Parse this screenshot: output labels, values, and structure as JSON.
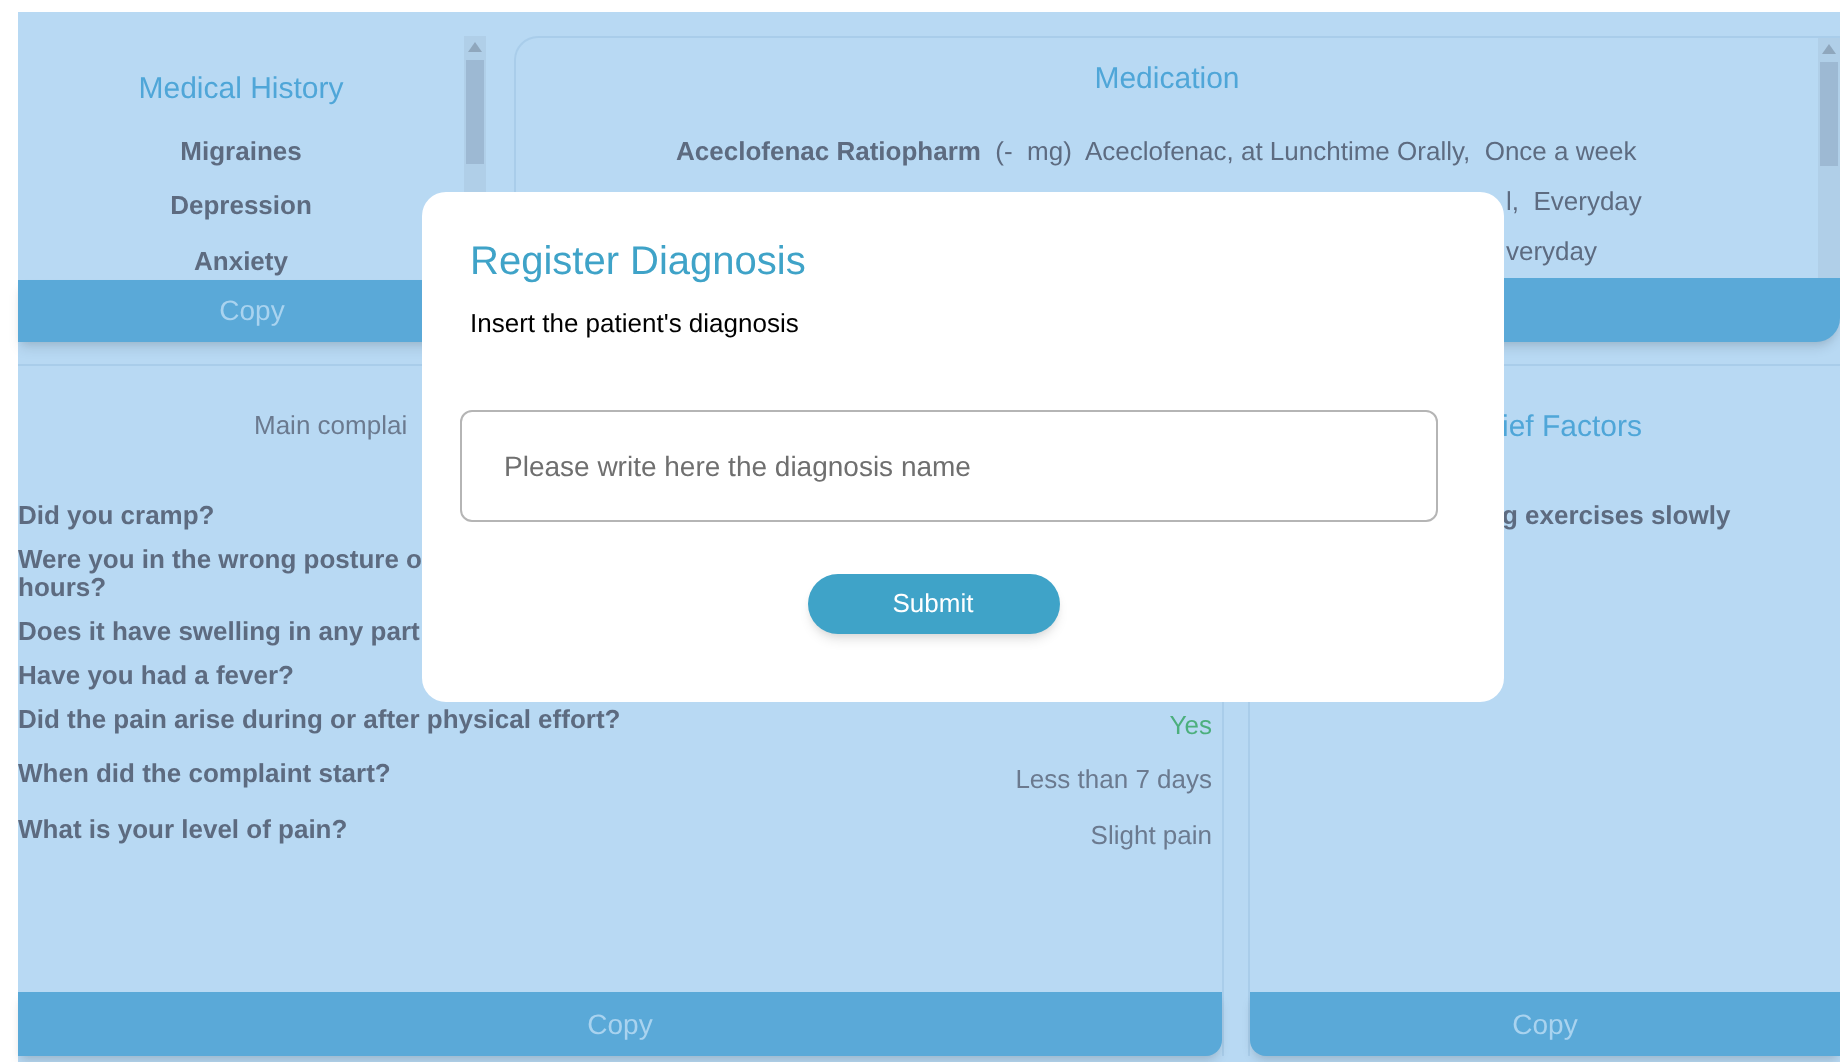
{
  "medical_history": {
    "title": "Medical History",
    "items": [
      "Migraines",
      "Depression",
      "Anxiety"
    ],
    "copy_label": "Copy"
  },
  "medication": {
    "title": "Medication",
    "rows": [
      {
        "name": "Aceclofenac Ratiopharm",
        "details": "(-  mg)  Aceclofenac, at Lunchtime Orally,  Once a week"
      },
      {
        "tail": "l,  Everyday"
      },
      {
        "tail": "veryday"
      }
    ]
  },
  "complaint": {
    "title": "Main complai",
    "questions": [
      {
        "text": "Did you cramp?"
      },
      {
        "text": "Were you in the wrong posture o\nhours?"
      },
      {
        "text": "Does it have swelling in any part"
      },
      {
        "text": "Have you had a fever?"
      },
      {
        "text": "Did the pain arise during or after physical effort?",
        "answer": "Yes",
        "color": "#4caf7d"
      },
      {
        "text": "When did the complaint start?",
        "answer": "Less than 7 days",
        "color": "#6b7a8f"
      },
      {
        "text": "What is your level of pain?",
        "answer": "Slight pain",
        "color": "#6b7a8f"
      }
    ],
    "copy_label": "Copy"
  },
  "relief": {
    "title": "ief Factors",
    "items": [
      "g exercises slowly"
    ],
    "copy_label": "Copy"
  },
  "dialog": {
    "title": "Register Diagnosis",
    "subtitle": "Insert the patient's diagnosis",
    "placeholder": "Please write here the diagnosis name",
    "submit": "Submit"
  }
}
